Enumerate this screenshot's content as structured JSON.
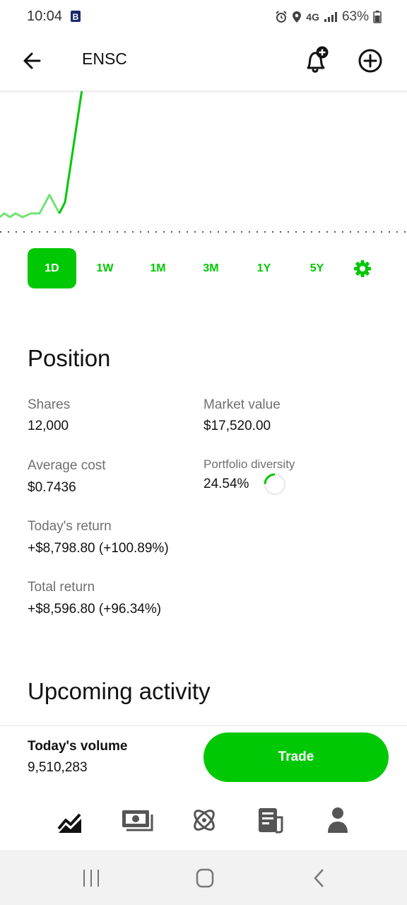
{
  "status_bar": {
    "time": "10:04",
    "network": "4G",
    "battery": "63%"
  },
  "header": {
    "ticker": "ENSC",
    "icons": [
      "back-arrow-icon",
      "bell-plus-icon",
      "add-circle-icon"
    ]
  },
  "chart_data": {
    "type": "line",
    "title": "",
    "series": [
      {
        "values": [
          30,
          31,
          30,
          31,
          30,
          31,
          31,
          36,
          31,
          34,
          75
        ]
      }
    ],
    "baseline_dotted": true,
    "color": "#00c805"
  },
  "ranges": {
    "items": [
      "1D",
      "1W",
      "1M",
      "3M",
      "1Y",
      "5Y"
    ],
    "active": "1D"
  },
  "position": {
    "title": "Position",
    "shares_label": "Shares",
    "shares_value": "12,000",
    "market_value_label": "Market value",
    "market_value_value": "$17,520.00",
    "avg_cost_label": "Average cost",
    "avg_cost_value": "$0.7436",
    "diversity_label": "Portfolio diversity",
    "diversity_value": "24.54%",
    "diversity_fraction": 0.2454,
    "todays_return_label": "Today's return",
    "todays_return_value": "+$8,798.80 (+100.89%)",
    "total_return_label": "Total return",
    "total_return_value": "+$8,596.80 (+96.34%)"
  },
  "upcoming": {
    "title": "Upcoming activity"
  },
  "footer": {
    "volume_label": "Today's volume",
    "volume_value": "9,510,283",
    "trade_label": "Trade"
  },
  "bottom_nav": [
    "chart-icon",
    "cash-icon",
    "crypto-icon",
    "news-icon",
    "profile-icon"
  ],
  "colors": {
    "accent": "#00c805",
    "text": "#111111",
    "muted": "#6f6f6f"
  }
}
